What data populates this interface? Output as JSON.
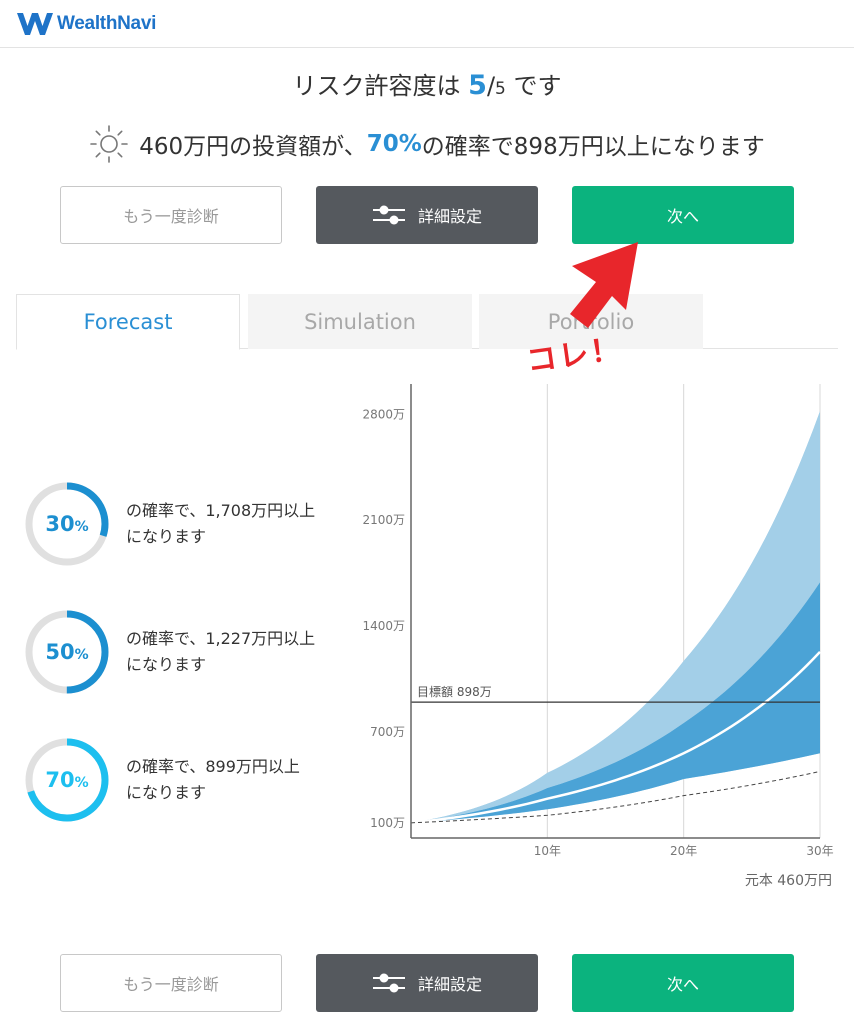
{
  "header": {
    "brand": "WealthNavi",
    "icon": "wealthnavi-logo-icon",
    "brand_color": "#1e73c8"
  },
  "summary": {
    "risk_prefix": "リスク許容度は ",
    "risk_value": "5",
    "risk_slash": "/",
    "risk_max": "5",
    "risk_suffix": " です",
    "sun_icon": "sun-icon",
    "forecast_prefix": "460万円の投資額が、",
    "forecast_prob": "70%",
    "forecast_suffix": "の確率で898万円以上になります"
  },
  "buttons": {
    "rediagnose": "もう一度診断",
    "advanced": "詳細設定",
    "next": "次へ",
    "settings_icon": "sliders-icon"
  },
  "tabs": [
    {
      "label": "Forecast",
      "active": true
    },
    {
      "label": "Simulation",
      "active": false
    },
    {
      "label": "Portfolio",
      "active": false
    }
  ],
  "annotation": {
    "text": "コレ！",
    "color": "#e8262b"
  },
  "probabilities": [
    {
      "value": "30",
      "unit": "%",
      "fraction": 0.3,
      "text": [
        "の確率で、1,708万円以上",
        "になります"
      ],
      "color": "#1c8fd0"
    },
    {
      "value": "50",
      "unit": "%",
      "fraction": 0.5,
      "text": [
        "の確率で、1,227万円以上",
        "になります"
      ],
      "color": "#1c8fd0"
    },
    {
      "value": "70",
      "unit": "%",
      "fraction": 0.7,
      "text": [
        "の確率で、899万円以上",
        "になります"
      ],
      "color": "#1dbfef"
    }
  ],
  "chart_data": {
    "type": "area",
    "y_ticks": [
      {
        "value": 100,
        "label": "100万"
      },
      {
        "value": 700,
        "label": "700万"
      },
      {
        "value": 1400,
        "label": "1400万"
      },
      {
        "value": 2100,
        "label": "2100万"
      },
      {
        "value": 2800,
        "label": "2800万"
      }
    ],
    "x_ticks": [
      {
        "value": 10,
        "label": "10年"
      },
      {
        "value": 20,
        "label": "20年"
      },
      {
        "value": 30,
        "label": "30年"
      }
    ],
    "xlim": [
      0,
      30
    ],
    "ylim": [
      0,
      3000
    ],
    "grid": true,
    "target": {
      "label": "目標額 898万",
      "value": 898
    },
    "principal_label": "元本 460万円",
    "x": [
      0,
      10,
      20,
      30
    ],
    "series": [
      {
        "values": [
          100,
          430,
          1170,
          2820
        ]
      },
      {
        "values": [
          100,
          330,
          760,
          1690
        ]
      },
      {
        "values": [
          100,
          260,
          560,
          1230
        ]
      },
      {
        "values": [
          100,
          190,
          390,
          560
        ]
      },
      {
        "values": [
          100,
          150,
          280,
          440
        ]
      }
    ],
    "colors": {
      "outer_band": "#a3cfe8",
      "inner_band": "#4ba3d6",
      "median": "#ffffff",
      "principal": "#444444",
      "axis": "#666666",
      "grid": "#d8d8d8"
    }
  }
}
